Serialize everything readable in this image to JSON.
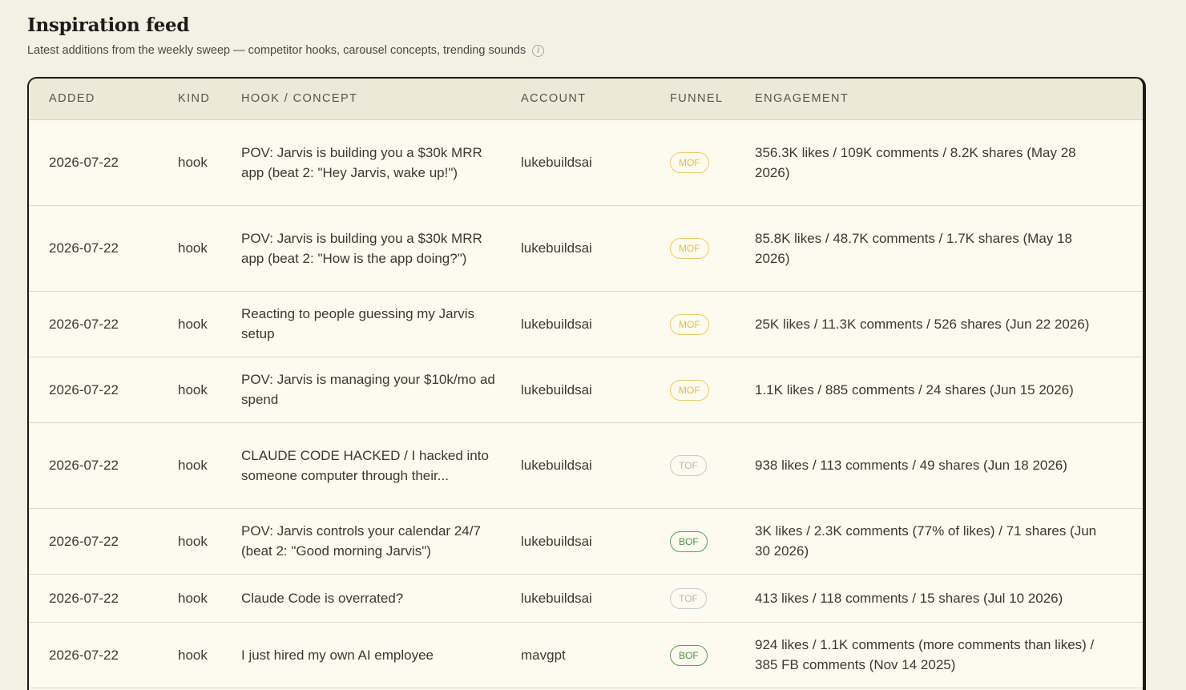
{
  "header": {
    "title": "Inspiration feed",
    "subtitle": "Latest additions from the weekly sweep — competitor hooks, carousel concepts, trending sounds",
    "info_icon": "i"
  },
  "table": {
    "columns": [
      "ADDED",
      "KIND",
      "HOOK / CONCEPT",
      "ACCOUNT",
      "FUNNEL",
      "ENGAGEMENT"
    ],
    "rows": [
      {
        "added": "2026-07-22",
        "kind": "hook",
        "hook": "POV: Jarvis is building you a $30k MRR app (beat 2: \"Hey Jarvis, wake up!\")",
        "account": "lukebuildsai",
        "funnel": "MOF",
        "engagement": "356.3K likes / 109K comments / 8.2K shares (May 28 2026)"
      },
      {
        "added": "2026-07-22",
        "kind": "hook",
        "hook": "POV: Jarvis is building you a $30k MRR app (beat 2: \"How is the app doing?\")",
        "account": "lukebuildsai",
        "funnel": "MOF",
        "engagement": "85.8K likes / 48.7K comments / 1.7K shares (May 18 2026)"
      },
      {
        "added": "2026-07-22",
        "kind": "hook",
        "hook": "Reacting to people guessing my Jarvis setup",
        "account": "lukebuildsai",
        "funnel": "MOF",
        "engagement": "25K likes / 11.3K comments / 526 shares (Jun 22 2026)"
      },
      {
        "added": "2026-07-22",
        "kind": "hook",
        "hook": "POV: Jarvis is managing your $10k/mo ad spend",
        "account": "lukebuildsai",
        "funnel": "MOF",
        "engagement": "1.1K likes / 885 comments / 24 shares (Jun 15 2026)"
      },
      {
        "added": "2026-07-22",
        "kind": "hook",
        "hook": "CLAUDE CODE HACKED / I hacked into someone computer through their...",
        "account": "lukebuildsai",
        "funnel": "TOF",
        "engagement": "938 likes / 113 comments / 49 shares (Jun 18 2026)"
      },
      {
        "added": "2026-07-22",
        "kind": "hook",
        "hook": "POV: Jarvis controls your calendar 24/7 (beat 2: \"Good morning Jarvis\")",
        "account": "lukebuildsai",
        "funnel": "BOF",
        "engagement": "3K likes / 2.3K comments (77% of likes) / 71 shares (Jun 30 2026)"
      },
      {
        "added": "2026-07-22",
        "kind": "hook",
        "hook": "Claude Code is overrated?",
        "account": "lukebuildsai",
        "funnel": "TOF",
        "engagement": "413 likes / 118 comments / 15 shares (Jul 10 2026)"
      },
      {
        "added": "2026-07-22",
        "kind": "hook",
        "hook": "I just hired my own AI employee",
        "account": "mavgpt",
        "funnel": "BOF",
        "engagement": "924 likes / 1.1K comments (more comments than likes) / 385 FB comments (Nov 14 2025)"
      }
    ]
  },
  "colors": {
    "page_background": "#f3f1e4",
    "table_background": "#fdfbef",
    "header_background": "#ece9d8",
    "mof_badge": "#e4bd4a",
    "tof_badge": "#b3bcc2",
    "bof_badge": "#4a8f4a"
  }
}
